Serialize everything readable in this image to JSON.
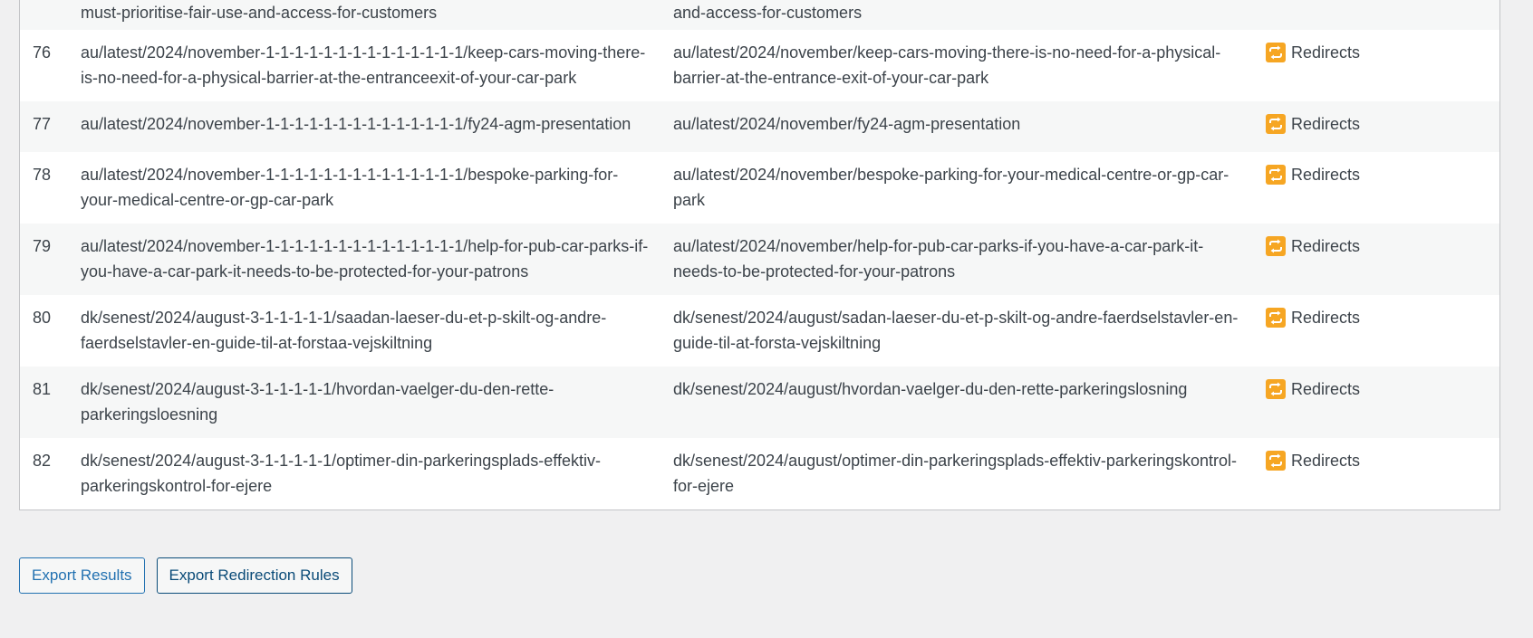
{
  "table": {
    "partial_row": {
      "source_tail": "must-prioritise-fair-use-and-access-for-customers",
      "target_tail": "and-access-for-customers"
    },
    "rows": [
      {
        "num": "76",
        "source": "au/latest/2024/november-1-1-1-1-1-1-1-1-1-1-1-1-1-1/keep-cars-moving-there-is-no-need-for-a-physical-barrier-at-the-entranceexit-of-your-car-park",
        "target": "au/latest/2024/november/keep-cars-moving-there-is-no-need-for-a-physical-barrier-at-the-entrance-exit-of-your-car-park",
        "status": "Redirects"
      },
      {
        "num": "77",
        "source": "au/latest/2024/november-1-1-1-1-1-1-1-1-1-1-1-1-1-1/fy24-agm-presentation",
        "target": "au/latest/2024/november/fy24-agm-presentation",
        "status": "Redirects"
      },
      {
        "num": "78",
        "source": "au/latest/2024/november-1-1-1-1-1-1-1-1-1-1-1-1-1-1/bespoke-parking-for-your-medical-centre-or-gp-car-park",
        "target": "au/latest/2024/november/bespoke-parking-for-your-medical-centre-or-gp-car-park",
        "status": "Redirects"
      },
      {
        "num": "79",
        "source": "au/latest/2024/november-1-1-1-1-1-1-1-1-1-1-1-1-1-1/help-for-pub-car-parks-if-you-have-a-car-park-it-needs-to-be-protected-for-your-patrons",
        "target": "au/latest/2024/november/help-for-pub-car-parks-if-you-have-a-car-park-it-needs-to-be-protected-for-your-patrons",
        "status": "Redirects"
      },
      {
        "num": "80",
        "source": "dk/senest/2024/august-3-1-1-1-1-1/saadan-laeser-du-et-p-skilt-og-andre-faerdselstavler-en-guide-til-at-forstaa-vejskiltning",
        "target": "dk/senest/2024/august/sadan-laeser-du-et-p-skilt-og-andre-faerdselstavler-en-guide-til-at-forsta-vejskiltning",
        "status": "Redirects"
      },
      {
        "num": "81",
        "source": "dk/senest/2024/august-3-1-1-1-1-1/hvordan-vaelger-du-den-rette-parkeringsloesning",
        "target": "dk/senest/2024/august/hvordan-vaelger-du-den-rette-parkeringslosning",
        "status": "Redirects"
      },
      {
        "num": "82",
        "source": "dk/senest/2024/august-3-1-1-1-1-1/optimer-din-parkeringsplads-effektiv-parkeringskontrol-for-ejere",
        "target": "dk/senest/2024/august/optimer-din-parkeringsplads-effektiv-parkeringskontrol-for-ejere",
        "status": "Redirects"
      }
    ]
  },
  "actions": {
    "export_results": "Export Results",
    "export_rules": "Export Redirection Rules"
  },
  "colors": {
    "redirect_icon": "#f6a623",
    "primary_link": "#2271b1",
    "dark_link": "#0a4b78"
  },
  "icons": {
    "status": "redirect-icon"
  }
}
